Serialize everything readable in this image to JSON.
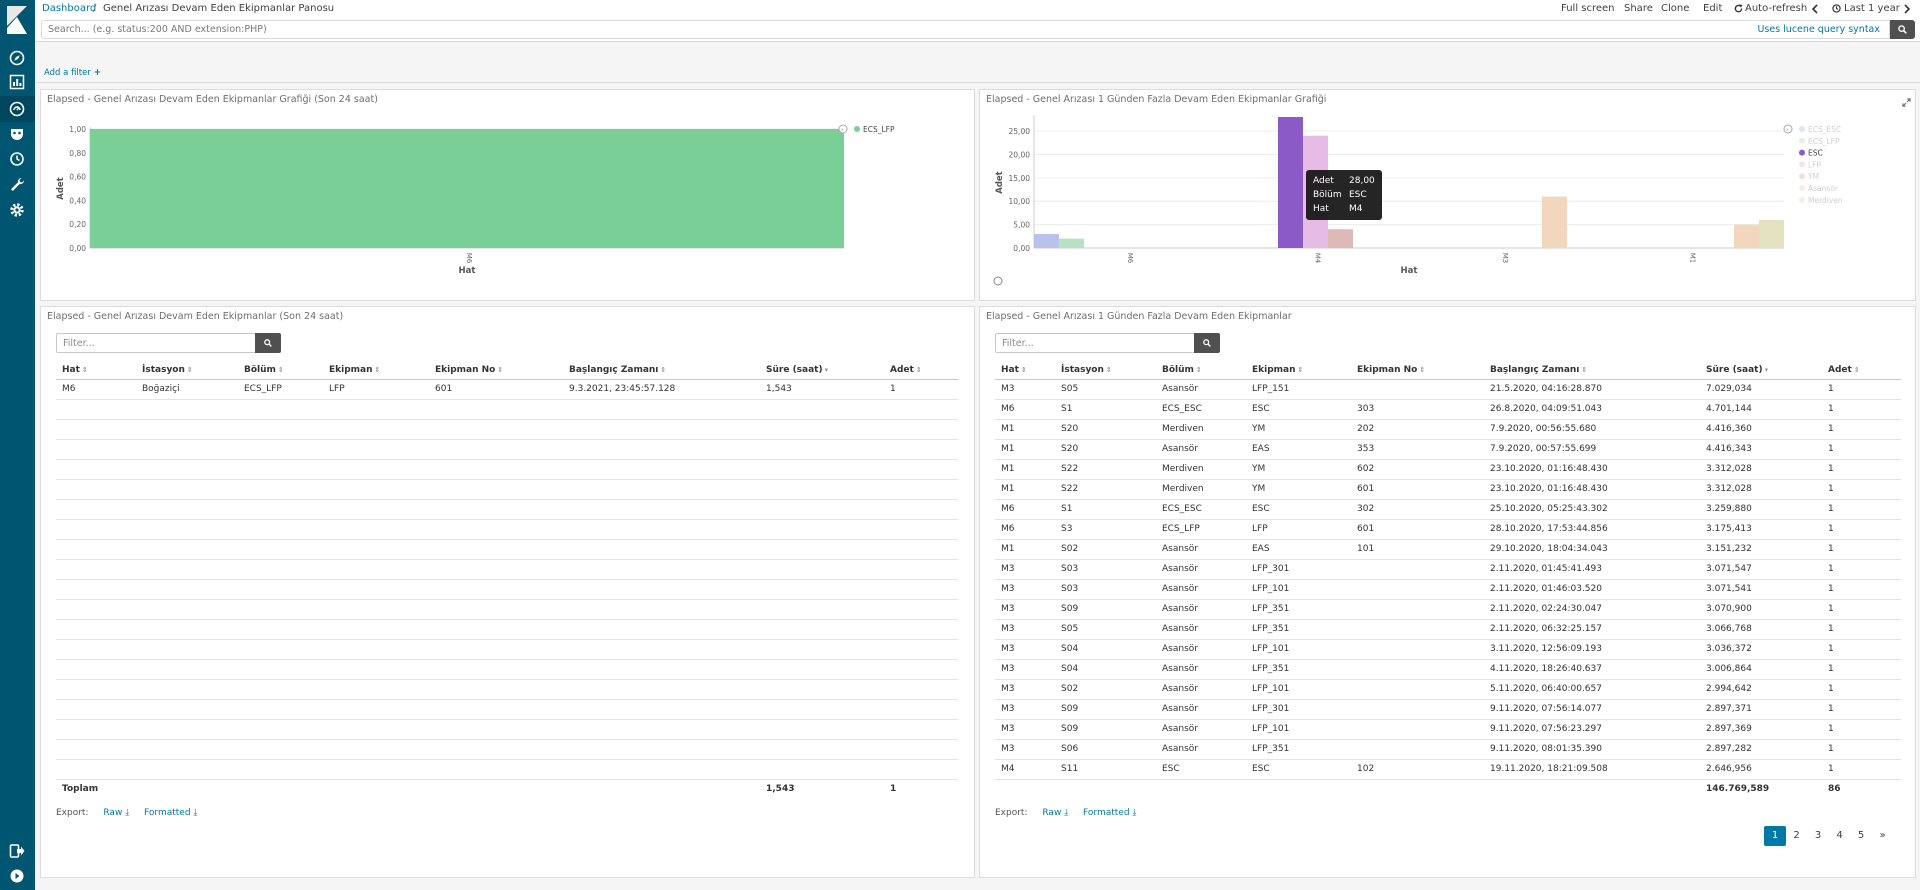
{
  "header": {
    "breadcrumb_root": "Dashboard",
    "breadcrumb_sep": "/",
    "breadcrumb_current": "Genel Arızası Devam Eden Ekipmanlar Panosu",
    "actions": {
      "full_screen": "Full screen",
      "share": "Share",
      "clone": "Clone",
      "edit": "Edit",
      "auto_refresh": "Auto-refresh",
      "time_range": "Last 1 year"
    }
  },
  "query": {
    "placeholder": "Search... (e.g. status:200 AND extension:PHP)",
    "lucene": "Uses lucene query syntax"
  },
  "filters": {
    "add_filter": "Add a filter"
  },
  "colors": {
    "sidebar": "#005571",
    "link": "#0079a5",
    "ecs_lfp": "#7acf96",
    "esc": "#8b5ac6"
  },
  "panels": {
    "tl": {
      "title": "Elapsed - Genel Arızası Devam Eden Ekipmanlar Grafiği (Son 24 saat)",
      "chart_data": {
        "type": "bar",
        "categories": [
          "M6"
        ],
        "series": [
          {
            "name": "ECS_LFP",
            "values": [
              1.0
            ],
            "color": "#7acf96"
          }
        ],
        "ylabel": "Adet",
        "xlabel": "Hat",
        "ylim": [
          0,
          1
        ],
        "yticks": [
          "0,00",
          "0,20",
          "0,40",
          "0,60",
          "0,80",
          "1,00"
        ],
        "legend": "top-right",
        "grid": true
      }
    },
    "tr": {
      "title": "Elapsed - Genel Arızası 1 Günden Fazla Devam Eden Ekipmanlar Grafiği",
      "chart_data": {
        "type": "bar",
        "categories": [
          "M6",
          "M4",
          "M3",
          "M1"
        ],
        "series": [
          {
            "name": "ECS_ESC",
            "color": "#b9c2ec",
            "values": [
              3,
              0,
              0,
              0
            ]
          },
          {
            "name": "ECS_LFP",
            "color": "#b5e2c5",
            "values": [
              2,
              0,
              0,
              0
            ]
          },
          {
            "name": "ESC",
            "color": "#8b5ac6",
            "values": [
              0,
              28,
              0,
              0
            ]
          },
          {
            "name": "LFP",
            "color": "#e6bce6",
            "values": [
              0,
              24,
              0,
              0
            ]
          },
          {
            "name": "YM",
            "color": "#dfb8b8",
            "values": [
              0,
              4,
              0,
              0
            ]
          },
          {
            "name": "Asansör",
            "color": "#f2d7be",
            "values": [
              0,
              0,
              11,
              5
            ]
          },
          {
            "name": "Merdiven",
            "color": "#e2e2c0",
            "values": [
              0,
              0,
              0,
              6
            ]
          }
        ],
        "ylabel": "Adet",
        "xlabel": "Hat",
        "ylim": [
          0,
          28
        ],
        "yticks": [
          "0,00",
          "5,00",
          "10,00",
          "15,00",
          "20,00",
          "25,00"
        ],
        "legend": "top-right",
        "grid": true,
        "tooltip": {
          "adet_label": "Adet",
          "adet": "28,00",
          "bolum_label": "Bölüm",
          "bolum": "ESC",
          "hat_label": "Hat",
          "hat": "M4"
        }
      }
    },
    "bl": {
      "title": "Elapsed - Genel Arızası Devam Eden Ekipmanlar (Son 24 saat)",
      "filter_placeholder": "Filter...",
      "columns": [
        "Hat",
        "İstasyon",
        "Bölüm",
        "Ekipman",
        "Ekipman No",
        "Başlangıç Zamanı",
        "Süre (saat)",
        "Adet"
      ],
      "rows": [
        [
          "M6",
          "Boğaziçi",
          "ECS_LFP",
          "LFP",
          "601",
          "9.3.2021, 23:45:57.128",
          "1,543",
          "1"
        ]
      ],
      "total": {
        "label": "Toplam",
        "sure": "1,543",
        "adet": "1"
      },
      "export": {
        "label": "Export:",
        "raw": "Raw",
        "formatted": "Formatted"
      }
    },
    "br": {
      "title": "Elapsed - Genel Arızası 1 Günden Fazla Devam Eden Ekipmanlar",
      "filter_placeholder": "Filter...",
      "columns": [
        "Hat",
        "İstasyon",
        "Bölüm",
        "Ekipman",
        "Ekipman No",
        "Başlangıç Zamanı",
        "Süre (saat)",
        "Adet"
      ],
      "rows": [
        [
          "M3",
          "S05",
          "Asansör",
          "LFP_151",
          "",
          "21.5.2020, 04:16:28.870",
          "7.029,034",
          "1"
        ],
        [
          "M6",
          "S1",
          "ECS_ESC",
          "ESC",
          "303",
          "26.8.2020, 04:09:51.043",
          "4.701,144",
          "1"
        ],
        [
          "M1",
          "S20",
          "Merdiven",
          "YM",
          "202",
          "7.9.2020, 00:56:55.680",
          "4.416,360",
          "1"
        ],
        [
          "M1",
          "S20",
          "Asansör",
          "EAS",
          "353",
          "7.9.2020, 00:57:55.699",
          "4.416,343",
          "1"
        ],
        [
          "M1",
          "S22",
          "Merdiven",
          "YM",
          "602",
          "23.10.2020, 01:16:48.430",
          "3.312,028",
          "1"
        ],
        [
          "M1",
          "S22",
          "Merdiven",
          "YM",
          "601",
          "23.10.2020, 01:16:48.430",
          "3.312,028",
          "1"
        ],
        [
          "M6",
          "S1",
          "ECS_ESC",
          "ESC",
          "302",
          "25.10.2020, 05:25:43.302",
          "3.259,880",
          "1"
        ],
        [
          "M6",
          "S3",
          "ECS_LFP",
          "LFP",
          "601",
          "28.10.2020, 17:53:44.856",
          "3.175,413",
          "1"
        ],
        [
          "M1",
          "S02",
          "Asansör",
          "EAS",
          "101",
          "29.10.2020, 18:04:34.043",
          "3.151,232",
          "1"
        ],
        [
          "M3",
          "S03",
          "Asansör",
          "LFP_301",
          "",
          "2.11.2020, 01:45:41.493",
          "3.071,547",
          "1"
        ],
        [
          "M3",
          "S03",
          "Asansör",
          "LFP_101",
          "",
          "2.11.2020, 01:46:03.520",
          "3.071,541",
          "1"
        ],
        [
          "M3",
          "S09",
          "Asansör",
          "LFP_351",
          "",
          "2.11.2020, 02:24:30.047",
          "3.070,900",
          "1"
        ],
        [
          "M3",
          "S05",
          "Asansör",
          "LFP_351",
          "",
          "2.11.2020, 06:32:25.157",
          "3.066,768",
          "1"
        ],
        [
          "M3",
          "S04",
          "Asansör",
          "LFP_101",
          "",
          "3.11.2020, 12:56:09.193",
          "3.036,372",
          "1"
        ],
        [
          "M3",
          "S04",
          "Asansör",
          "LFP_351",
          "",
          "4.11.2020, 18:26:40.637",
          "3.006,864",
          "1"
        ],
        [
          "M3",
          "S02",
          "Asansör",
          "LFP_101",
          "",
          "5.11.2020, 06:40:00.657",
          "2.994,642",
          "1"
        ],
        [
          "M3",
          "S09",
          "Asansör",
          "LFP_301",
          "",
          "9.11.2020, 07:56:14.077",
          "2.897,371",
          "1"
        ],
        [
          "M3",
          "S09",
          "Asansör",
          "LFP_101",
          "",
          "9.11.2020, 07:56:23.297",
          "2.897,369",
          "1"
        ],
        [
          "M3",
          "S06",
          "Asansör",
          "LFP_351",
          "",
          "9.11.2020, 08:01:35.390",
          "2.897,282",
          "1"
        ],
        [
          "M4",
          "S11",
          "ESC",
          "ESC",
          "102",
          "19.11.2020, 18:21:09.508",
          "2.646,956",
          "1"
        ]
      ],
      "total": {
        "label": "",
        "sure": "146.769,589",
        "adet": "86"
      },
      "export": {
        "label": "Export:",
        "raw": "Raw",
        "formatted": "Formatted"
      },
      "pagination": [
        "1",
        "2",
        "3",
        "4",
        "5",
        "»"
      ],
      "current_page": "1"
    }
  }
}
